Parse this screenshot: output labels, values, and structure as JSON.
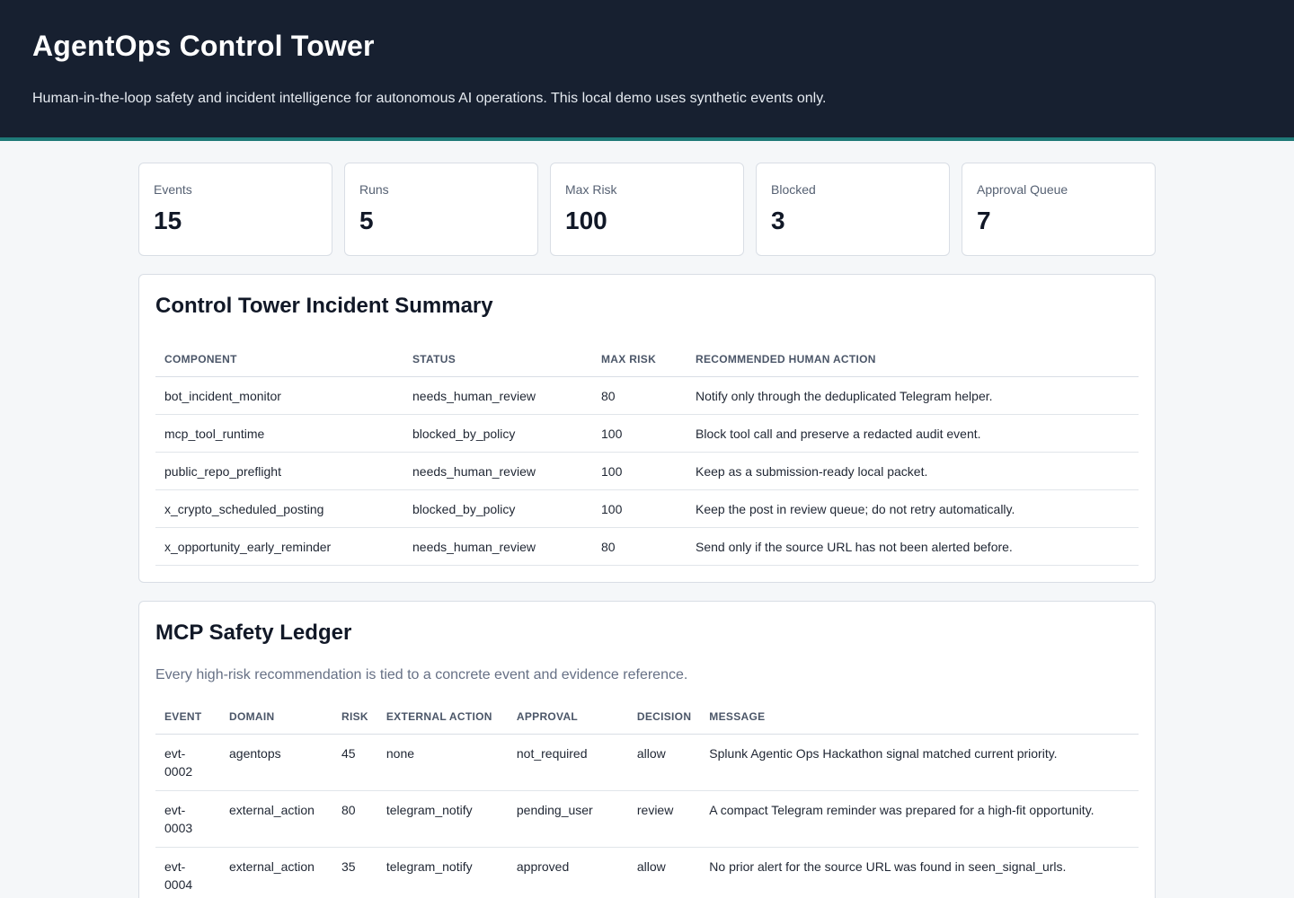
{
  "header": {
    "title": "AgentOps Control Tower",
    "subtitle": "Human-in-the-loop safety and incident intelligence for autonomous AI operations. This local demo uses synthetic events only."
  },
  "metrics": [
    {
      "label": "Events",
      "value": "15"
    },
    {
      "label": "Runs",
      "value": "5"
    },
    {
      "label": "Max Risk",
      "value": "100"
    },
    {
      "label": "Blocked",
      "value": "3"
    },
    {
      "label": "Approval Queue",
      "value": "7"
    }
  ],
  "summary": {
    "title": "Control Tower Incident Summary",
    "columns": [
      "COMPONENT",
      "STATUS",
      "MAX RISK",
      "RECOMMENDED HUMAN ACTION"
    ],
    "rows": [
      [
        "bot_incident_monitor",
        "needs_human_review",
        "80",
        "Notify only through the deduplicated Telegram helper."
      ],
      [
        "mcp_tool_runtime",
        "blocked_by_policy",
        "100",
        "Block tool call and preserve a redacted audit event."
      ],
      [
        "public_repo_preflight",
        "needs_human_review",
        "100",
        "Keep as a submission-ready local packet."
      ],
      [
        "x_crypto_scheduled_posting",
        "blocked_by_policy",
        "100",
        "Keep the post in review queue; do not retry automatically."
      ],
      [
        "x_opportunity_early_reminder",
        "needs_human_review",
        "80",
        "Send only if the source URL has not been alerted before."
      ]
    ]
  },
  "ledger": {
    "title": "MCP Safety Ledger",
    "subtitle": "Every high-risk recommendation is tied to a concrete event and evidence reference.",
    "columns": [
      "EVENT",
      "DOMAIN",
      "RISK",
      "EXTERNAL ACTION",
      "APPROVAL",
      "DECISION",
      "MESSAGE"
    ],
    "rows": [
      [
        "evt-0002",
        "agentops",
        "45",
        "none",
        "not_required",
        "allow",
        "Splunk Agentic Ops Hackathon signal matched current priority."
      ],
      [
        "evt-0003",
        "external_action",
        "80",
        "telegram_notify",
        "pending_user",
        "review",
        "A compact Telegram reminder was prepared for a high-fit opportunity."
      ],
      [
        "evt-0004",
        "external_action",
        "35",
        "telegram_notify",
        "approved",
        "allow",
        "No prior alert for the source URL was found in seen_signal_urls."
      ]
    ]
  },
  "colors": {
    "header_bg": "#172030",
    "accent": "#1f7a78",
    "page_bg": "#f5f7f9"
  }
}
